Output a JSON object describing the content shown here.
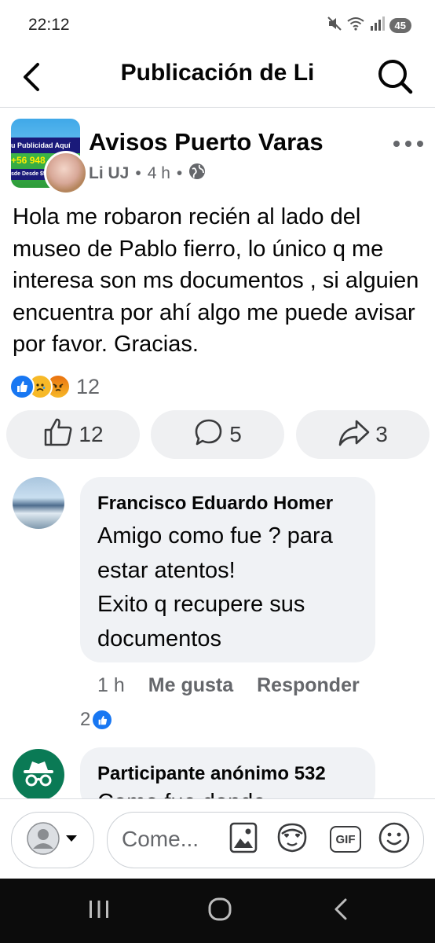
{
  "status_bar": {
    "time": "22:12",
    "battery": "45"
  },
  "header": {
    "title": "Publicación de Li",
    "back_icon": "back-arrow-icon",
    "search_icon": "search-icon"
  },
  "post": {
    "page_name": "Avisos Puerto Varas",
    "page_avatar_text": {
      "line1": "u Publicidad Aquí",
      "line2": "+56 948",
      "line3": "sde Desde $5.0"
    },
    "author": "Li UJ",
    "time": "4 h",
    "separator": "•",
    "privacy_icon": "globe-icon",
    "text": "Hola me robaron recién al lado del museo de Pablo fierro, lo único q me interesa son ms documentos , si alguien encuentra por ahí algo me puede avisar por favor. Gracias.",
    "reactions": {
      "types": [
        "like",
        "sad",
        "angry"
      ],
      "count": "12"
    },
    "actions": {
      "likes": "12",
      "comments": "5",
      "shares": "3"
    }
  },
  "comments": [
    {
      "author": "Francisco Eduardo Homer",
      "text_lines": [
        "Amigo como fue ? para",
        "estar atentos!",
        "Exito q recupere sus",
        "documentos"
      ],
      "time": "1 h",
      "like_label": "Me gusta",
      "reply_label": "Responder",
      "reaction_count": "2"
    },
    {
      "author": "Participante anónimo 532",
      "avatar_icon": "incognito-icon",
      "partial_text": "Como fue donde"
    }
  ],
  "composer": {
    "placeholder": "Come...",
    "icons": [
      "photo-icon",
      "avatar-sticker-icon",
      "gif-icon",
      "emoji-icon"
    ],
    "gif_label": "GIF"
  },
  "colors": {
    "accent": "#1877f2",
    "text": "#050505",
    "secondary": "#65676b",
    "bubble": "#f0f2f5",
    "anon_green": "#0a7a55"
  }
}
